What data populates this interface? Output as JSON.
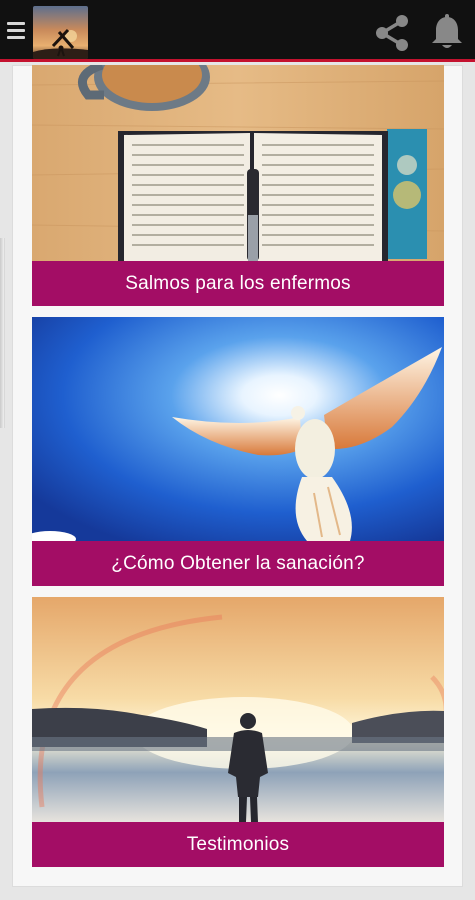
{
  "header": {
    "menu_icon": "hamburger-menu-icon",
    "logo_icon": "cross-sunset-logo",
    "share_icon": "share-icon",
    "bell_icon": "bell-icon",
    "accent_color": "#c4122f"
  },
  "cards": [
    {
      "caption": "Salmos para los enfermos",
      "image": "open-bible-and-coffee-image"
    },
    {
      "caption": "¿Cómo Obtener la sanación?",
      "image": "white-dove-sun-sky-image"
    },
    {
      "caption": "Testimonios",
      "image": "person-at-lake-sunset-rainbow-image"
    }
  ],
  "caption_color": "#a30d65"
}
